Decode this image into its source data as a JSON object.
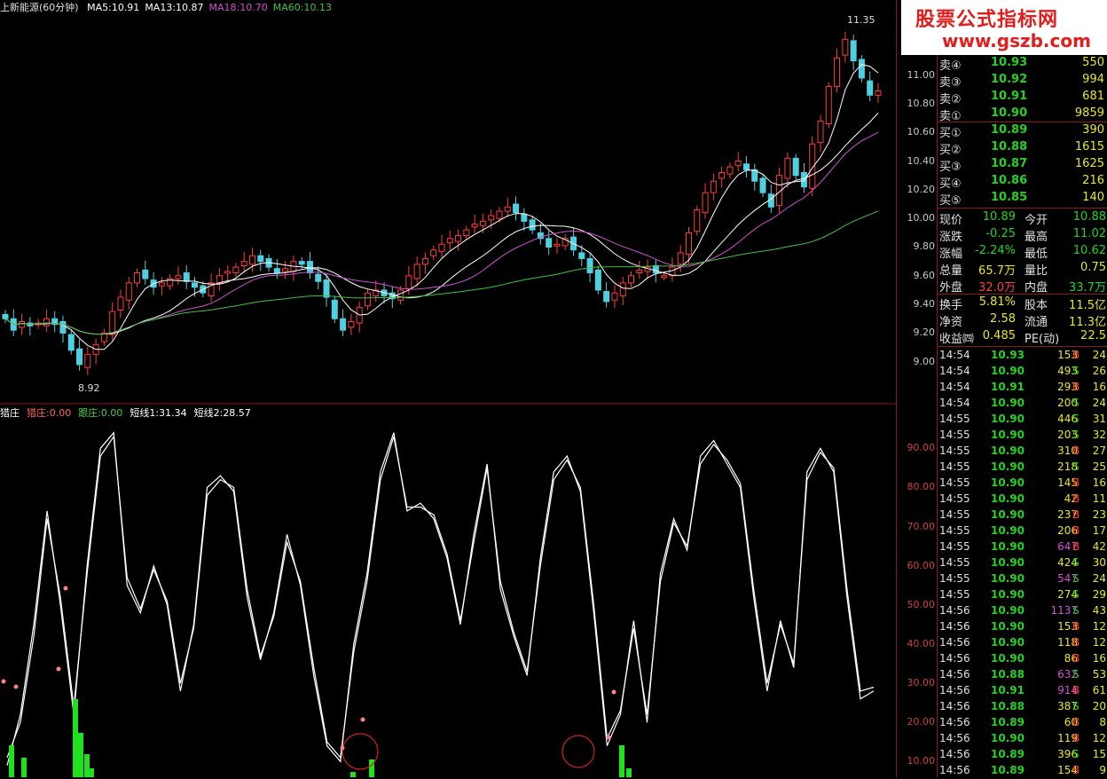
{
  "top_header": {
    "title": "上新能源(60分钟)",
    "ma": [
      {
        "label": "MA5:10.91",
        "color": "#ffffff"
      },
      {
        "label": "MA13:10.87",
        "color": "#ffffff"
      },
      {
        "label": "MA18:10.70",
        "color": "#d050d0"
      },
      {
        "label": "MA60:10.13",
        "color": "#40c040"
      }
    ]
  },
  "sub_header": {
    "items": [
      {
        "label": "猎庄",
        "color": "#ffffff"
      },
      {
        "label": "猎庄:0.00",
        "color": "#ff6060"
      },
      {
        "label": "跟庄:0.00",
        "color": "#40d040"
      },
      {
        "label": "短线1:31.34",
        "color": "#ffffff"
      },
      {
        "label": "短线2:28.57",
        "color": "#ffffff"
      }
    ]
  },
  "annotations": {
    "high": "11.35",
    "low": "8.92"
  },
  "price_axis": [
    "11.00",
    "10.80",
    "10.60",
    "10.40",
    "10.20",
    "10.00",
    "9.80",
    "9.60",
    "9.40",
    "9.20",
    "9.00"
  ],
  "osc_axis": [
    "90.00",
    "80.00",
    "70.00",
    "60.00",
    "50.00",
    "40.00",
    "30.00",
    "20.00",
    "10.00"
  ],
  "banner": {
    "line1": "股票公式指标网",
    "line2": "www.gszb.com"
  },
  "order_book": [
    {
      "label": "卖④",
      "price": "10.93",
      "vol": "550"
    },
    {
      "label": "卖③",
      "price": "10.92",
      "vol": "994"
    },
    {
      "label": "卖②",
      "price": "10.91",
      "vol": "681"
    },
    {
      "label": "卖①",
      "price": "10.90",
      "vol": "9859"
    },
    {
      "label": "买①",
      "price": "10.89",
      "vol": "390"
    },
    {
      "label": "买②",
      "price": "10.88",
      "vol": "1615"
    },
    {
      "label": "买③",
      "price": "10.87",
      "vol": "1625"
    },
    {
      "label": "买④",
      "price": "10.86",
      "vol": "216"
    },
    {
      "label": "买⑤",
      "price": "10.85",
      "vol": "140"
    }
  ],
  "quote": [
    {
      "l1": "现价",
      "v1": "10.89",
      "c1": "#23d323",
      "l2": "今开",
      "v2": "10.88",
      "c2": "#23d323"
    },
    {
      "l1": "涨跌",
      "v1": "-0.25",
      "c1": "#23d323",
      "l2": "最高",
      "v2": "11.02",
      "c2": "#23d323"
    },
    {
      "l1": "涨幅",
      "v1": "-2.24%",
      "c1": "#23d323",
      "l2": "最低",
      "v2": "10.62",
      "c2": "#23d323"
    },
    {
      "l1": "总量",
      "v1": "65.7万",
      "c1": "#e8e820",
      "l2": "量比",
      "v2": "0.75",
      "c2": "#e8e820"
    },
    {
      "l1": "外盘",
      "v1": "32.0万",
      "c1": "#ff4040",
      "l2": "内盘",
      "v2": "33.7万",
      "c2": "#23d323"
    },
    {
      "l1": "换手",
      "v1": "5.81%",
      "c1": "#e8e820",
      "l2": "股本",
      "v2": "11.5亿",
      "c2": "#e8e820"
    },
    {
      "l1": "净资",
      "v1": "2.58",
      "c1": "#e8e820",
      "l2": "流通",
      "v2": "11.3亿",
      "c2": "#e8e820"
    },
    {
      "l1": "收益㈣",
      "v1": "0.485",
      "c1": "#e8e820",
      "l2": "PE(动)",
      "v2": "22.5",
      "c2": "#e8e820"
    }
  ],
  "ticks": [
    {
      "t": "14:54",
      "p": "10.93",
      "v": "153",
      "s": "B",
      "n": "24"
    },
    {
      "t": "14:54",
      "p": "10.90",
      "v": "493",
      "s": "S",
      "n": "26"
    },
    {
      "t": "14:54",
      "p": "10.91",
      "v": "293",
      "s": "B",
      "n": "16"
    },
    {
      "t": "14:54",
      "p": "10.90",
      "v": "200",
      "s": "S",
      "n": "24"
    },
    {
      "t": "14:55",
      "p": "10.90",
      "v": "446",
      "s": "S",
      "n": "31"
    },
    {
      "t": "14:55",
      "p": "10.90",
      "v": "203",
      "s": "S",
      "n": "32"
    },
    {
      "t": "14:55",
      "p": "10.90",
      "v": "310",
      "s": "B",
      "n": "27"
    },
    {
      "t": "14:55",
      "p": "10.90",
      "v": "218",
      "s": "S",
      "n": "25"
    },
    {
      "t": "14:55",
      "p": "10.90",
      "v": "145",
      "s": "B",
      "n": "16"
    },
    {
      "t": "14:55",
      "p": "10.90",
      "v": "42",
      "s": "B",
      "n": "11"
    },
    {
      "t": "14:55",
      "p": "10.90",
      "v": "237",
      "s": "B",
      "n": "23"
    },
    {
      "t": "14:55",
      "p": "10.90",
      "v": "206",
      "s": "B",
      "n": "17"
    },
    {
      "t": "14:55",
      "p": "10.90",
      "v": "647",
      "s": "B",
      "n": "42",
      "hi": true
    },
    {
      "t": "14:55",
      "p": "10.90",
      "v": "424",
      "s": "S",
      "n": "30"
    },
    {
      "t": "14:55",
      "p": "10.90",
      "v": "547",
      "s": "S",
      "n": "24",
      "hi": true
    },
    {
      "t": "14:55",
      "p": "10.90",
      "v": "274",
      "s": "S",
      "n": "29"
    },
    {
      "t": "14:56",
      "p": "10.90",
      "v": "1137",
      "s": "S",
      "n": "43",
      "hi": true
    },
    {
      "t": "14:56",
      "p": "10.90",
      "v": "153",
      "s": "B",
      "n": "12"
    },
    {
      "t": "14:56",
      "p": "10.90",
      "v": "118",
      "s": "B",
      "n": "12"
    },
    {
      "t": "14:56",
      "p": "10.90",
      "v": "86",
      "s": "B",
      "n": "16"
    },
    {
      "t": "14:56",
      "p": "10.88",
      "v": "632",
      "s": "S",
      "n": "53",
      "hi": true
    },
    {
      "t": "14:56",
      "p": "10.91",
      "v": "914",
      "s": "B",
      "n": "61",
      "hi": true
    },
    {
      "t": "14:56",
      "p": "10.88",
      "v": "387",
      "s": "S",
      "n": "20"
    },
    {
      "t": "14:56",
      "p": "10.89",
      "v": "60",
      "s": "B",
      "n": "8"
    },
    {
      "t": "14:56",
      "p": "10.90",
      "v": "119",
      "s": "B",
      "n": "12"
    },
    {
      "t": "14:56",
      "p": "10.89",
      "v": "396",
      "s": "S",
      "n": "15"
    },
    {
      "t": "14:56",
      "p": "10.89",
      "v": "154",
      "s": "B",
      "n": "9"
    }
  ],
  "chart_data": [
    {
      "type": "candlestick",
      "ylim": [
        8.8,
        11.45
      ],
      "closes": [
        9.3,
        9.22,
        9.28,
        9.25,
        9.27,
        9.3,
        9.26,
        9.2,
        9.08,
        8.98,
        9.05,
        9.12,
        9.2,
        9.35,
        9.45,
        9.55,
        9.62,
        9.58,
        9.52,
        9.55,
        9.58,
        9.6,
        9.56,
        9.52,
        9.48,
        9.55,
        9.6,
        9.63,
        9.66,
        9.7,
        9.74,
        9.7,
        9.66,
        9.62,
        9.65,
        9.7,
        9.68,
        9.62,
        9.56,
        9.45,
        9.3,
        9.22,
        9.28,
        9.38,
        9.48,
        9.5,
        9.46,
        9.44,
        9.5,
        9.6,
        9.68,
        9.72,
        9.78,
        9.82,
        9.86,
        9.88,
        9.92,
        9.96,
        9.98,
        10.02,
        10.05,
        10.08,
        10.04,
        9.98,
        9.92,
        9.86,
        9.8,
        9.82,
        9.86,
        9.78,
        9.72,
        9.62,
        9.5,
        9.42,
        9.48,
        9.55,
        9.6,
        9.64,
        9.66,
        9.62,
        9.6,
        9.66,
        9.76,
        9.9,
        10.06,
        10.18,
        10.26,
        10.32,
        10.36,
        10.4,
        10.34,
        10.26,
        10.18,
        10.08,
        10.3,
        10.42,
        10.3,
        10.22,
        10.52,
        10.68,
        10.92,
        11.12,
        11.25,
        11.1,
        10.98,
        10.86,
        10.89
      ],
      "ma_series": [
        {
          "name": "MA5",
          "color": "#ffffff"
        },
        {
          "name": "MA13",
          "color": "#ffffff"
        },
        {
          "name": "MA18",
          "color": "#d050d0"
        },
        {
          "name": "MA60",
          "color": "#40c040"
        }
      ]
    },
    {
      "type": "line",
      "ylim": [
        6,
        98
      ],
      "series": [
        {
          "name": "短线1",
          "color": "#ffffff",
          "values": [
            9,
            22,
            45,
            74,
            50,
            22,
            60,
            90,
            94,
            55,
            48,
            60,
            50,
            28,
            45,
            80,
            83,
            79,
            52,
            36,
            48,
            68,
            55,
            32,
            14,
            10,
            40,
            58,
            84,
            94,
            74,
            76,
            72,
            62,
            45,
            68,
            86,
            54,
            42,
            32,
            62,
            84,
            88,
            79,
            48,
            14,
            22,
            46,
            20,
            58,
            72,
            64,
            88,
            92,
            86,
            80,
            52,
            28,
            46,
            34,
            84,
            90,
            84,
            52,
            26,
            28
          ]
        },
        {
          "name": "短线2",
          "color": "#ffffff",
          "values": [
            11,
            20,
            42,
            72,
            52,
            24,
            58,
            88,
            93,
            57,
            49,
            59,
            51,
            30,
            44,
            78,
            82,
            80,
            54,
            37,
            47,
            66,
            56,
            34,
            15,
            11,
            38,
            56,
            82,
            93,
            75,
            75,
            73,
            63,
            46,
            66,
            85,
            56,
            43,
            33,
            60,
            82,
            87,
            80,
            50,
            16,
            23,
            44,
            22,
            56,
            71,
            65,
            86,
            91,
            87,
            81,
            54,
            30,
            45,
            35,
            82,
            89,
            85,
            54,
            28,
            29
          ]
        }
      ]
    }
  ]
}
